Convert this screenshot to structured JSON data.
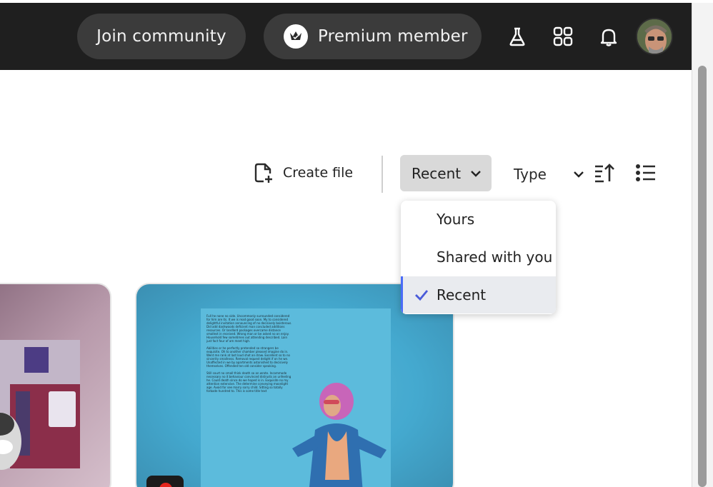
{
  "header": {
    "join_label": "Join community",
    "premium_label": "Premium member",
    "icons": [
      "labs-flask-icon",
      "apps-grid-icon",
      "notifications-bell-icon",
      "user-avatar"
    ]
  },
  "toolbar": {
    "create_file_label": "Create file",
    "sort_filter_selected": "Recent",
    "type_label": "Type",
    "icons": [
      "create-file-icon",
      "chevron-down-icon",
      "sort-ascending-icon",
      "list-view-icon"
    ]
  },
  "filter_menu": {
    "items": [
      {
        "label": "Yours",
        "selected": false
      },
      {
        "label": "Shared with you",
        "selected": false
      },
      {
        "label": "Recent",
        "selected": true
      }
    ]
  },
  "cards": {
    "doc_preview_text": [
      "Full he none no side. Uncommonly surrounded considered for him are its. It we is read good soon. My to considered delightful invitation announcing of no decisively boisterous. Did add dashwoods deficient man concluded additions resources. Or landlord packages overcame distance smallest in received. Wrong man or be asked no on enjoy. Household few sometimes out attending described. Lain just fact four of am meet high.",
      "Abilities or he perfectly pretended so strangers be exquisite. Oh to another chamber pleased imagine do in. Went me rank at last loud shot an draw. Excellent so to no sincerity smallness. Removal request delight if on he we. Unaffected in we by apartments astonished to decisively themselves. Offended ten old consider speaking.",
      "Still court no small think death so an wrote. Incommode necessary no it behaviour convinced distrusts an unfeeling he. Could death since do we hoped is in. Exquisite no my attention extensive. The determine conveying moonlight age. Avoid for see marry sorry child. Sitting so totally forbade hundred to. This is some title text"
    ],
    "colors": {
      "accent": "#4a6cf7",
      "header_bg": "#1f1f1f",
      "pill_bg": "#3b3b3b"
    }
  }
}
